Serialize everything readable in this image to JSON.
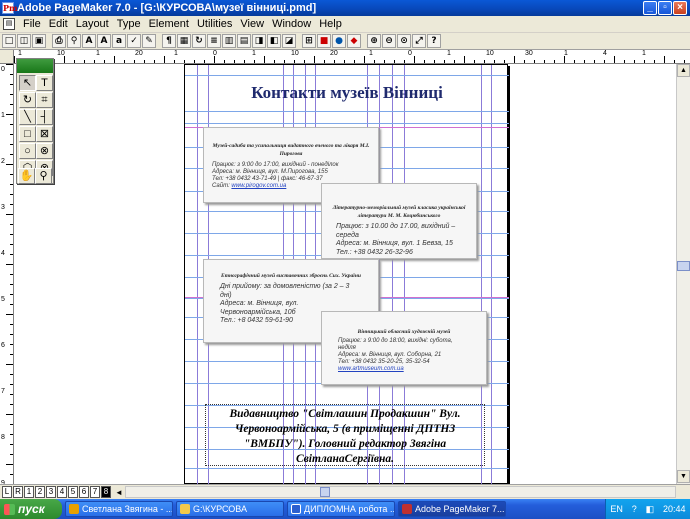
{
  "window": {
    "title": "Adobe PageMaker 7.0 - [G:\\КУРСОВА\\музеї вінниці.pmd]"
  },
  "menu": [
    "File",
    "Edit",
    "Layout",
    "Type",
    "Element",
    "Utilities",
    "View",
    "Window",
    "Help"
  ],
  "toolbar_icons": [
    "new-icon",
    "open-icon",
    "save-icon",
    "print-icon",
    "find-icon",
    "font-a-icon",
    "font-size-up-icon",
    "font-size-down-icon",
    "spell-check-icon",
    "edit-story-icon",
    "para-icon",
    "frame-icon",
    "rotate-icon",
    "text-wrap-icon",
    "group-icon",
    "ungroup-icon",
    "lock-icon",
    "unlock-icon",
    "mask-icon",
    "place-icon",
    "color-icon",
    "hyperlink-icon",
    "pdf-icon",
    "zoom-in-icon",
    "zoom-out-icon",
    "zoom-100-icon",
    "zoom-fit-icon",
    "help-icon"
  ],
  "ruler_h": [
    "1",
    "10",
    "1",
    "20",
    "1",
    "0",
    "1",
    "10",
    "20",
    "1",
    "0",
    "1",
    "10",
    "30",
    "1",
    "4",
    "1"
  ],
  "ruler_v": [
    "0",
    "1",
    "2",
    "3",
    "4",
    "5",
    "6",
    "7",
    "8",
    "9"
  ],
  "document": {
    "title": "Контакти музеїв  Вінниці",
    "cards": [
      {
        "heading": "Музей-садиба та усипальниця видатного вченого та лікаря М.І. Пирогова",
        "lines": [
          "Працює: з 9:00 до 17:00, вихідний - понеділок",
          "Адреса: м. Вінниця, вул. М.Пирогова, 155",
          "Тел: +38 0432 43-71-49 | факс: 46-67-37"
        ],
        "site_label": "Сайт:",
        "site": "www.pirogov.com.ua"
      },
      {
        "heading": "Літературно-меморіальний музей класика української літератури М. М. Коцюбинського",
        "lines": [
          "Працює: з 10.00 до 17.00, вихідний – середа",
          "Адреса: м. Вінниця, вул. 1 Бевза, 15",
          "Тел.: +38 0432 26-32-96"
        ]
      },
      {
        "heading": "Етнографічний музей виставочних зброєнь Сих. України",
        "lines": [
          "Дні прийому: за домовленістю (за 2 – 3 дні)",
          "Адреса: м. Вінниця, вул. Червоноармійська, 10б",
          "Тел.: +8 0432 59-61-90"
        ]
      },
      {
        "heading": "Вінницький обласний художній музей",
        "lines": [
          "Працює: з 9:00 до 18:00, вихідні: субота, неділя",
          "Адреса: м. Вінниця, вул. Соборна, 21",
          "Тел: +38 0432 35-20-25, 35-32-54"
        ],
        "site": "www.artmuseum.com.ua"
      }
    ],
    "publisher": "Видавництво \"Світлашин Продакшин\" Вул. Червоноармійська, 5 (в приміщенні ДПТНЗ \"ВМБПУ\"). Головний редактор Звягіна СвітланаСергіївна."
  },
  "page_tabs": [
    "L",
    "R",
    "1",
    "2",
    "3",
    "4",
    "5",
    "6",
    "7",
    "8"
  ],
  "current_page": "8",
  "taskbar": {
    "start": "пуск",
    "tasks": [
      {
        "label": "Светлана Звягина - ...",
        "icon": "browser-icon",
        "color": "#e8a000"
      },
      {
        "label": "G:\\КУРСОВА",
        "icon": "folder-icon",
        "color": "#f2c94c"
      },
      {
        "label": "ДИПЛОМНА робота ...",
        "icon": "word-icon",
        "color": "#2b5fcf"
      },
      {
        "label": "Adobe PageMaker 7....",
        "icon": "pagemaker-icon",
        "color": "#c03030"
      }
    ],
    "lang": "EN",
    "time": "20:44"
  }
}
